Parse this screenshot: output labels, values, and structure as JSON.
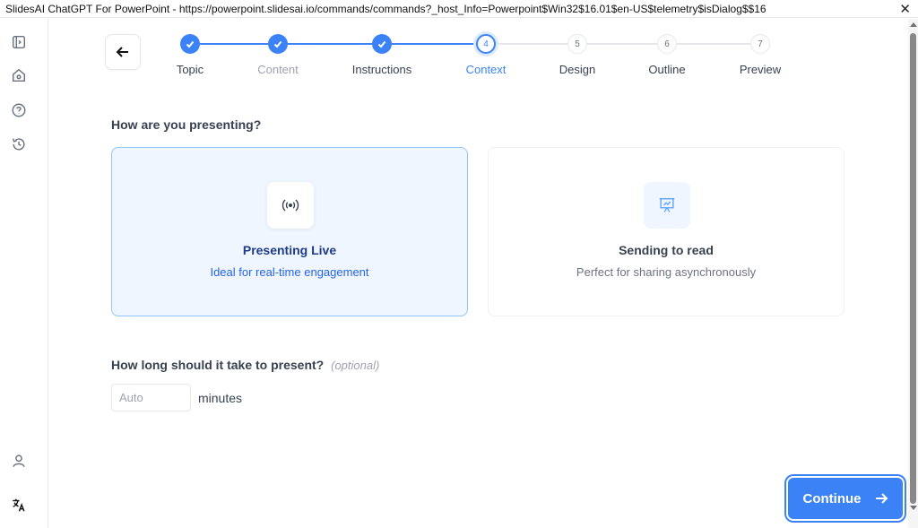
{
  "window": {
    "title": "SlidesAI ChatGPT For PowerPoint - https://powerpoint.slidesai.io/commands/commands?_host_Info=Powerpoint$Win32$16.01$en-US$telemetry$isDialog$$16",
    "close_glyph": "✕"
  },
  "sidebar": {
    "items": [
      {
        "name": "sidebar-toggle-icon"
      },
      {
        "name": "home-icon"
      },
      {
        "name": "help-icon"
      },
      {
        "name": "history-icon"
      },
      {
        "name": "user-icon"
      },
      {
        "name": "translate-icon"
      }
    ]
  },
  "stepper": {
    "steps": [
      {
        "label": "Topic",
        "status": "done"
      },
      {
        "label": "Content",
        "status": "done"
      },
      {
        "label": "Instructions",
        "status": "done"
      },
      {
        "label": "Context",
        "number": "4",
        "status": "active"
      },
      {
        "label": "Design",
        "number": "5",
        "status": "todo"
      },
      {
        "label": "Outline",
        "number": "6",
        "status": "todo"
      },
      {
        "label": "Preview",
        "number": "7",
        "status": "todo"
      }
    ]
  },
  "presenting": {
    "question": "How are you presenting?",
    "options": [
      {
        "title": "Presenting Live",
        "subtitle": "Ideal for real-time engagement",
        "icon": "broadcast-icon",
        "selected": true
      },
      {
        "title": "Sending to read",
        "subtitle": "Perfect for sharing asynchronously",
        "icon": "presentation-chart-icon",
        "selected": false
      }
    ]
  },
  "duration": {
    "question": "How long should it take to present?",
    "optional_label": "(optional)",
    "placeholder": "Auto",
    "unit": "minutes"
  },
  "continue_label": "Continue",
  "colors": {
    "accent": "#3b82f6",
    "selected_bg": "#eff6ff"
  }
}
